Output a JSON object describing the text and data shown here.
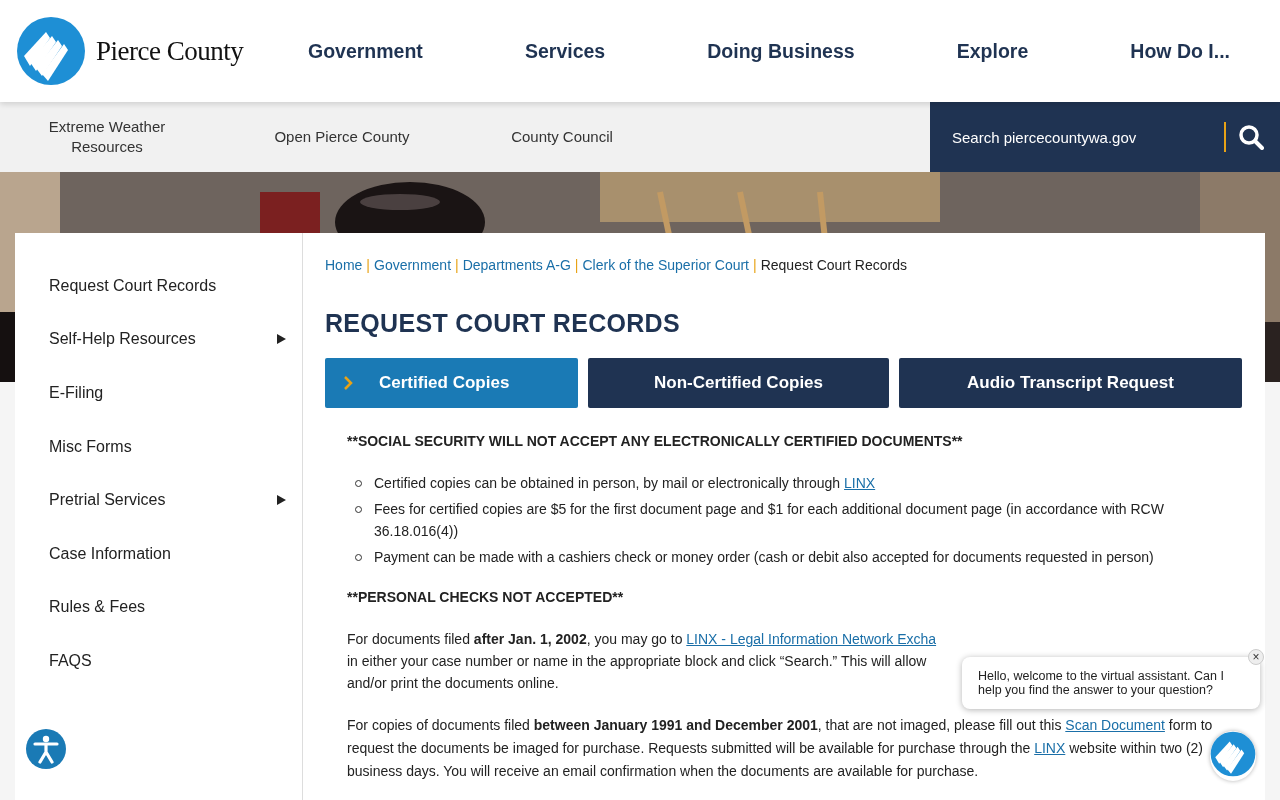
{
  "header": {
    "logo_text": "Pierce County",
    "nav": [
      "Government",
      "Services",
      "Doing Business",
      "Explore",
      "How Do I..."
    ]
  },
  "subnav": {
    "links": [
      "Extreme Weather Resources",
      "Open Pierce County",
      "County Council"
    ],
    "search": {
      "placeholder": "Search piercecountywa.gov"
    }
  },
  "sidebar": {
    "items": [
      {
        "label": "Request Court Records",
        "expandable": false
      },
      {
        "label": "Self-Help Resources",
        "expandable": true
      },
      {
        "label": "E-Filing",
        "expandable": false
      },
      {
        "label": "Misc Forms",
        "expandable": false
      },
      {
        "label": "Pretrial Services",
        "expandable": true
      },
      {
        "label": "Case Information",
        "expandable": false
      },
      {
        "label": "Rules & Fees",
        "expandable": false
      },
      {
        "label": "FAQS",
        "expandable": false
      }
    ]
  },
  "breadcrumb": [
    {
      "label": "Home",
      "link": true
    },
    {
      "separator": "|",
      "label": "Government",
      "link": true
    },
    {
      "separator": "|",
      "label": "Departments A-G",
      "link": true
    },
    {
      "separator": "|",
      "label": "Clerk of the Superior Court",
      "link": true
    },
    {
      "separator": "|",
      "label": "Request Court Records",
      "link": false
    }
  ],
  "page_title": "REQUEST COURT RECORDS",
  "tabs": [
    {
      "label": "Certified Copies",
      "selected": true
    },
    {
      "label": "Non-Certified Copies",
      "selected": false
    },
    {
      "label": "Audio Transcript Request",
      "selected": false
    }
  ],
  "notice_1": "**SOCIAL SECURITY WILL NOT ACCEPT ANY ELECTRONICALLY CERTIFIED DOCUMENTS**",
  "bullets": [
    {
      "text": "Certified copies can be obtained in person, by mail or electronically through ",
      "link": "LINX"
    },
    {
      "text": "Fees for certified copies are $5 for the first document page and $1 for each additional document page (in accordance with RCW 36.18.016(4))"
    },
    {
      "text": "Payment can be made with a cashiers check or money order (cash or debit also accepted for documents requested in person)"
    }
  ],
  "notice_2": "**PERSONAL CHECKS NOT ACCEPTED**",
  "paragraph_1": {
    "lines": [
      {
        "text": "For documents filed **after Jan. 1, 2002**, you may go to ",
        "link": "LINX - Legal Information Network Excha"
      },
      {
        "text": "in either your case number or name in the appropriate block and click “Search.” This will allow"
      },
      {
        "text": "and/or print the documents online."
      }
    ]
  },
  "paragraph_2": {
    "parts": [
      {
        "text": "For copies of documents filed **between January 1991 and December 2001**, that are not imaged, please fill out this "
      },
      {
        "link": "Scan Document"
      },
      {
        "text": " form to request the documents be imaged for purchase. Requests submitted will be available for purchase through the "
      },
      {
        "link": "LINX"
      },
      {
        "text": " website within two (2) business days. You will receive an email confirmation when the documents are available for purchase."
      }
    ]
  },
  "chat": {
    "message": "Hello, welcome to the virtual assistant. Can I help you find the answer to your question?",
    "close": "×"
  }
}
